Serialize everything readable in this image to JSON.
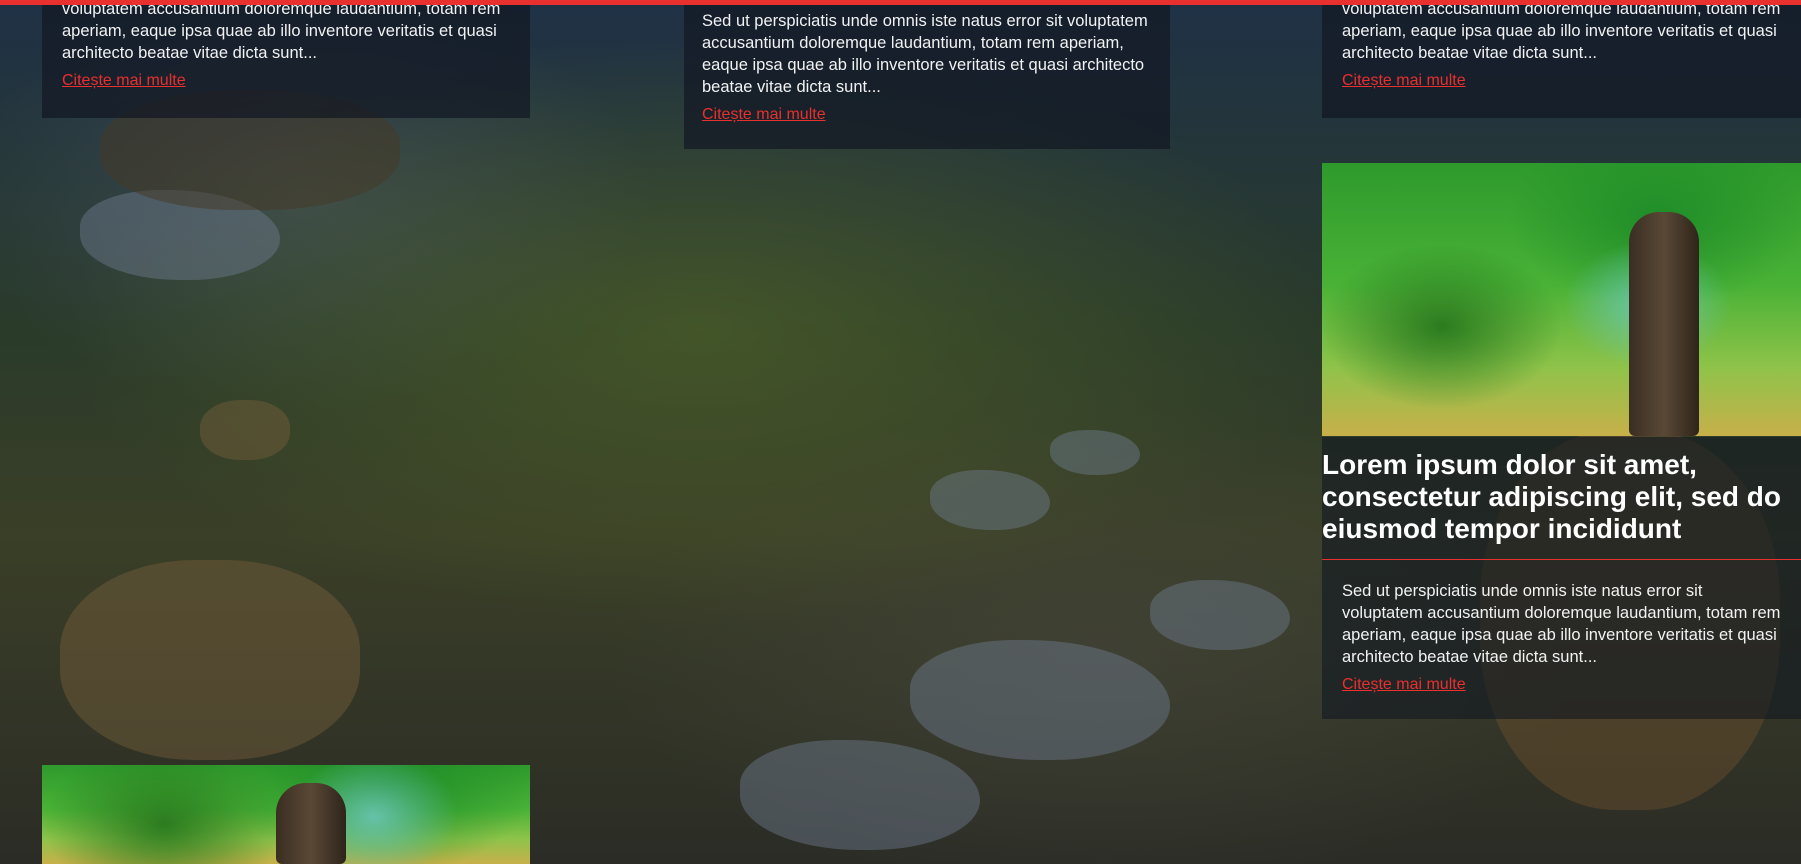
{
  "accent_color": "#e8302f",
  "cards": [
    {
      "excerpt": "voluptatem accusantium doloremque laudantium, totam rem aperiam, eaque ipsa quae ab illo inventore veritatis et quasi architecto beatae vitae dicta sunt...",
      "read_more": "Citește mai multe"
    },
    {
      "excerpt": "Sed ut perspiciatis unde omnis iste natus error sit voluptatem accusantium doloremque laudantium, totam rem aperiam, eaque ipsa quae ab illo inventore veritatis et quasi architecto beatae vitae dicta sunt...",
      "read_more": "Citește mai multe"
    },
    {
      "excerpt": "voluptatem accusantium doloremque laudantium, totam rem aperiam, eaque ipsa quae ab illo inventore veritatis et quasi architecto beatae vitae dicta sunt...",
      "read_more": "Citește mai multe"
    },
    {
      "title": "Lorem ipsum dolor sit amet, consectetur adipiscing elit, sed do eiusmod tempor incididunt",
      "excerpt": "Sed ut perspiciatis unde omnis iste natus error sit voluptatem accusantium doloremque laudantium, totam rem aperiam, eaque ipsa quae ab illo inventore veritatis et quasi architecto beatae vitae dicta sunt...",
      "read_more": "Citește mai multe"
    }
  ]
}
